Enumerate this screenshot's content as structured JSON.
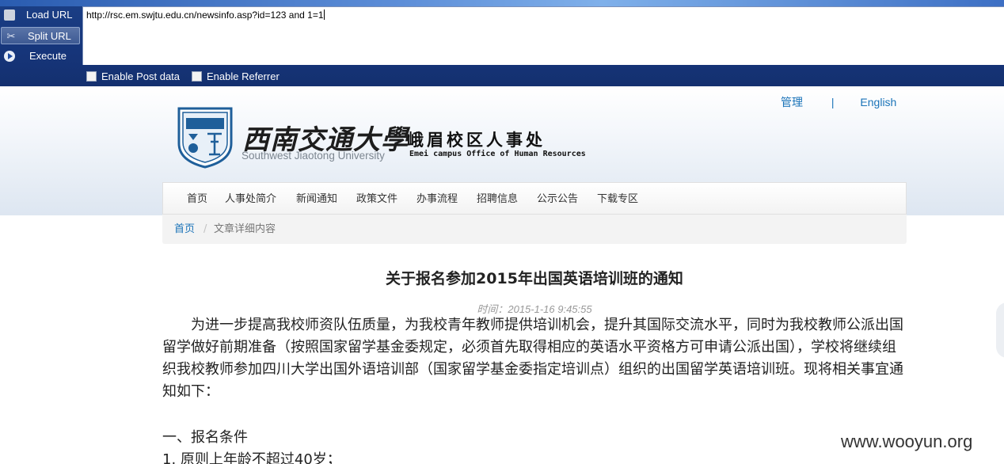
{
  "toolbar": {
    "load_label": "Load URL",
    "split_label": "Split URL",
    "execute_label": "Execute",
    "url_value": "http://rsc.em.swjtu.edu.cn/newsinfo.asp?id=123 and 1=1",
    "post_label": "Enable Post data",
    "referrer_label": "Enable Referrer",
    "icons": [
      "load-url-icon",
      "split-url-icon",
      "execute-icon"
    ]
  },
  "header": {
    "admin_link": "管理",
    "separator": "|",
    "english_link": "English",
    "logo_calligraphy": "西南交通大學",
    "logo_english": "Southwest Jiaotong University",
    "office_cn": "峨眉校区人事处",
    "office_en": "Emei campus Office of Human Resources"
  },
  "nav": {
    "items": [
      {
        "label": "首页"
      },
      {
        "label": "人事处简介"
      },
      {
        "label": "新闻通知"
      },
      {
        "label": "政策文件"
      },
      {
        "label": "办事流程"
      },
      {
        "label": "招聘信息"
      },
      {
        "label": "公示公告"
      },
      {
        "label": "下载专区"
      }
    ]
  },
  "breadcrumb": {
    "home": "首页",
    "separator": "/",
    "current": "文章详细内容"
  },
  "article": {
    "title": "关于报名参加2015年出国英语培训班的通知",
    "time": "时间：2015-1-16 9:45:55",
    "paragraph": "为进一步提高我校师资队伍质量，为我校青年教师提供培训机会，提升其国际交流水平，同时为我校教师公派出国留学做好前期准备（按照国家留学基金委规定，必须首先取得相应的英语水平资格方可申请公派出国），学校将继续组织我校教师参加四川大学出国外语培训部（国家留学基金委指定培训点）组织的出国留学英语培训班。现将相关事宜通知如下：",
    "section1": "一、报名条件",
    "item1": "1. 原则上年龄不超过40岁；"
  },
  "watermark": "www.wooyun.org",
  "colors": {
    "toolbar_bg": "#16357a",
    "link": "#1a73b8",
    "text": "#222222"
  }
}
